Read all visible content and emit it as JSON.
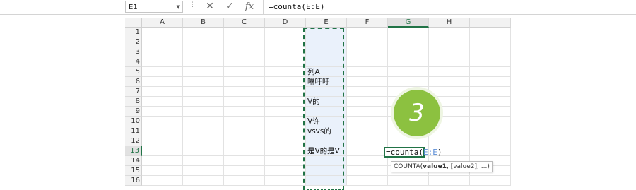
{
  "formula_bar": {
    "name_box": "E1",
    "cancel_icon": "close-icon",
    "enter_icon": "check-icon",
    "fx_label": "fx",
    "formula": "=counta(E:E)"
  },
  "columns": [
    "A",
    "B",
    "C",
    "D",
    "E",
    "F",
    "G",
    "H",
    "I"
  ],
  "rows": [
    "1",
    "2",
    "3",
    "4",
    "5",
    "6",
    "7",
    "8",
    "9",
    "10",
    "11",
    "12",
    "13",
    "14",
    "15",
    "16"
  ],
  "cells": {
    "E5": "列A",
    "E6": "啉吁吁",
    "E8": "V的",
    "E10": "V许",
    "E11": "vsvs的",
    "E13": "是V的是V"
  },
  "edit_cell": {
    "prefix": "=counta(",
    "ref": "E:E",
    "suffix": ")"
  },
  "tooltip": {
    "fn": "COUNTA(",
    "arg1": "value1",
    "rest": ", [value2], ...)"
  },
  "badge": "3",
  "colors": {
    "accent": "#217346",
    "selected_column": "#eaf1fb",
    "badge": "#8cc140"
  }
}
